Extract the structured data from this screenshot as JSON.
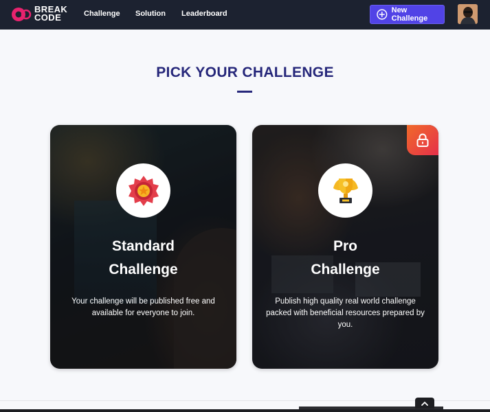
{
  "brand": {
    "line1": "BREAK",
    "line2": "CODE",
    "accent_color": "#e8236e"
  },
  "nav": {
    "items": [
      {
        "label": "Challenge"
      },
      {
        "label": "Solution"
      },
      {
        "label": "Leaderboard"
      }
    ],
    "new_challenge_label": "New Challenge",
    "new_challenge_icon": "plus-circle-icon",
    "button_color": "#5143e6"
  },
  "page": {
    "title": "PICK YOUR CHALLENGE",
    "title_color": "#26277a"
  },
  "cards": [
    {
      "title_line1": "Standard",
      "title_line2": "Challenge",
      "description": "Your challenge will be published free and available for everyone to join.",
      "icon": "medal-badge-icon",
      "locked": false
    },
    {
      "title_line1": "Pro",
      "title_line2": "Challenge",
      "description": "Publish high quality real world challenge packed with beneficial resources prepared by you.",
      "icon": "trophy-icon",
      "locked": true,
      "lock_icon": "lock-icon"
    }
  ],
  "scroll_top_icon": "chevron-up-icon"
}
